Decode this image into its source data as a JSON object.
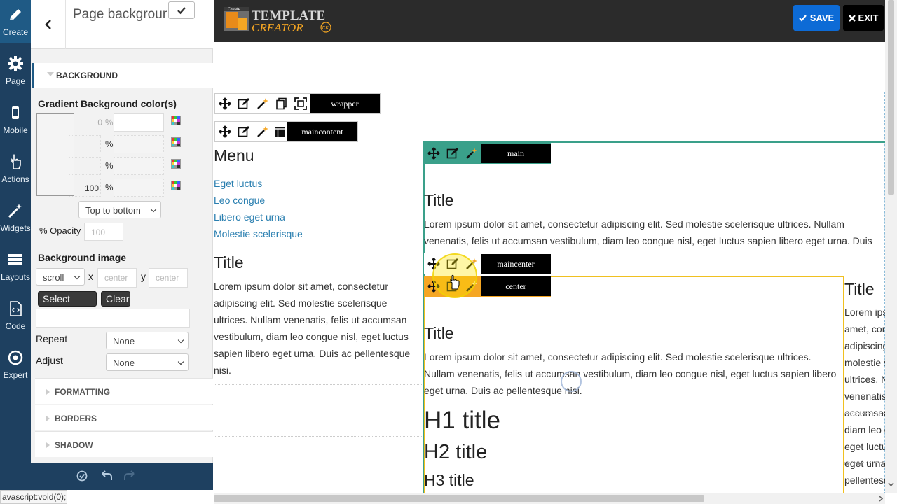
{
  "rail": [
    {
      "label": "Create",
      "icon": "pencil-icon"
    },
    {
      "label": "Page",
      "icon": "gear-icon"
    },
    {
      "label": "Mobile",
      "icon": "mobile-icon"
    },
    {
      "label": "Actions",
      "icon": "hand-pointer-icon"
    },
    {
      "label": "Widgets",
      "icon": "magic-wand-icon"
    },
    {
      "label": "Layouts",
      "icon": "grid-icon"
    },
    {
      "label": "Code",
      "icon": "code-file-icon"
    },
    {
      "label": "Expert",
      "icon": "target-icon"
    }
  ],
  "panel": {
    "title": "Page background",
    "section": "BACKGROUND",
    "gradient_label": "Gradient",
    "bgcolors_label": "Background color(s)",
    "gradient_rows": [
      {
        "position": "0",
        "unit": "%"
      },
      {
        "position": "",
        "unit": "%"
      },
      {
        "position": "",
        "unit": "%"
      },
      {
        "position": "100",
        "unit": "%"
      }
    ],
    "direction": "Top to bottom",
    "opacity_label": "% Opacity",
    "opacity_placeholder": "100",
    "bg_image_label": "Background image",
    "attachment": "scroll",
    "x_label": "x",
    "x_placeholder": "center",
    "y_label": "y",
    "y_placeholder": "center",
    "select_label": "Select",
    "clear_label": "Clear",
    "repeat_label": "Repeat",
    "repeat_value": "None",
    "adjust_label": "Adjust",
    "adjust_value": "None",
    "accordions": [
      "FORMATTING",
      "BORDERS",
      "SHADOW"
    ]
  },
  "header": {
    "logo_small": "Create",
    "logo_main": "TEMPLATE",
    "logo_sub": "CREATOR",
    "logo_badge": "CK",
    "save_label": "SAVE",
    "exit_label": "EXIT"
  },
  "blocks": {
    "wrapper": "wrapper",
    "maincontent": "maincontent",
    "main": "main",
    "maincenter": "maincenter",
    "center": "center"
  },
  "content": {
    "menu_title": "Menu",
    "menu_links": [
      "Eget luctus",
      "Leo congue",
      "Libero eget urna",
      "Molestie scelerisque"
    ],
    "left_title": "Title",
    "left_text": "Lorem ipsum dolor sit amet, consectetur adipiscing elit. Sed molestie scelerisque ultrices. Nullam venenatis, felis ut accumsan vestibulum, diam leo congue nisl, eget luctus sapien libero eget urna. Duis ac pellentesque nisi.",
    "main_title": "Title",
    "main_text": "Lorem ipsum dolor sit amet, consectetur adipiscing elit. Sed molestie scelerisque ultrices. Nullam venenatis, felis ut accumsan vestibulum, diam leo congue nisl, eget luctus sapien libero eget urna. Duis ac pellentesque nisi.",
    "center_title": "Title",
    "center_text": "Lorem ipsum dolor sit amet, consectetur adipiscing elit. Sed molestie scelerisque ultrices. Nullam venenatis, felis ut accumsan vestibulum, diam leo congue nisl, eget luctus sapien libero eget urna. Duis ac pellentesque nisi.",
    "h1": "H1 title",
    "h2": "H2 title",
    "h3": "H3 title",
    "right_title": "Title",
    "right_text": "Lorem ipsum dolor sit amet, consectetur adipiscing elit. Sed molestie scelerisque ultrices. Nullam venenatis, felis ut accumsan vestibulum, diam leo congue nisl, eget luctus sapien libero eget urna. Duis ac pellentesque nisi."
  },
  "status_text": "avascript:void(0);",
  "colors": {
    "rail_bg": "#1e4060",
    "rail_active": "#1f5a85",
    "save_blue": "#0d6bd6",
    "main_border": "#3aa08a",
    "center_border": "#f0c020",
    "center_toolbar": "#f5a623"
  }
}
